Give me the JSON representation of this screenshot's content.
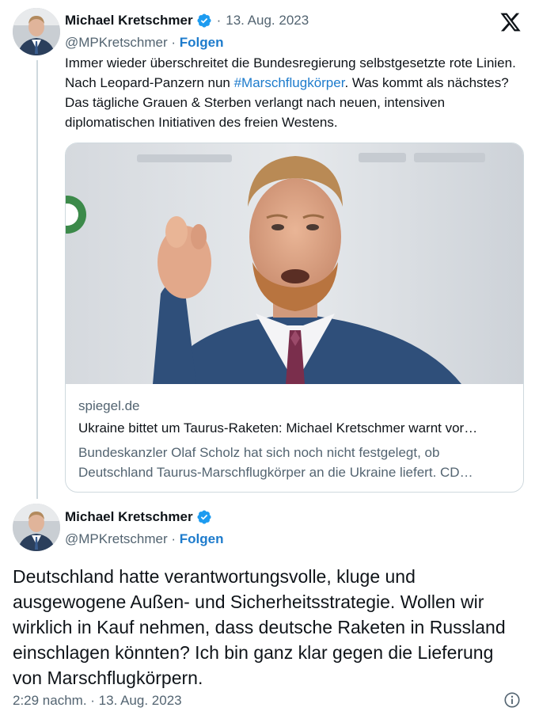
{
  "tweet1": {
    "author_name": "Michael Kretschmer",
    "separator": "·",
    "date": "13. Aug. 2023",
    "handle": "@MPKretschmer",
    "handle_separator": " · ",
    "follow_label": "Folgen",
    "text_part1": "Immer wieder überschreitet die Bundesregierung selbstgesetzte rote Linien. Nach Leopard-Panzern nun ",
    "hashtag": "#Marschflugkörper",
    "text_part2": ". Was kommt als nächstes? Das tägliche Grauen & Sterben verlangt nach neuen, intensiven diplomatischen Initiativen des freien Westens.",
    "card": {
      "domain": "spiegel.de",
      "title": "Ukraine bittet um Taurus-Raketen: Michael Kretschmer warnt vor…",
      "description": "Bundeskanzler Olaf Scholz hat sich noch nicht festgelegt, ob Deutschland Taurus-Marschflugkörper an die Ukraine liefert. CD…"
    }
  },
  "tweet2": {
    "author_name": "Michael Kretschmer",
    "handle": "@MPKretschmer",
    "handle_separator": " · ",
    "follow_label": "Folgen",
    "text": "Deutschland hatte verantwortungsvolle, kluge und ausgewogene Außen- und Sicherheitsstrategie. Wollen wir wirklich in Kauf nehmen, dass deutsche Raketen in Russland einschlagen könnten? Ich bin ganz klar gegen die Lieferung von Marschflugkörpern.",
    "time": "2:29 nachm.",
    "footer_separator": " · ",
    "date": "13. Aug. 2023"
  },
  "colors": {
    "accent": "#1d7bcc",
    "verified": "#1d9bf0",
    "secondary_text": "#536471",
    "border": "#cfd9de"
  },
  "icons": {
    "verified": "verified-badge-icon",
    "platform": "x-logo-icon",
    "info": "info-icon"
  }
}
